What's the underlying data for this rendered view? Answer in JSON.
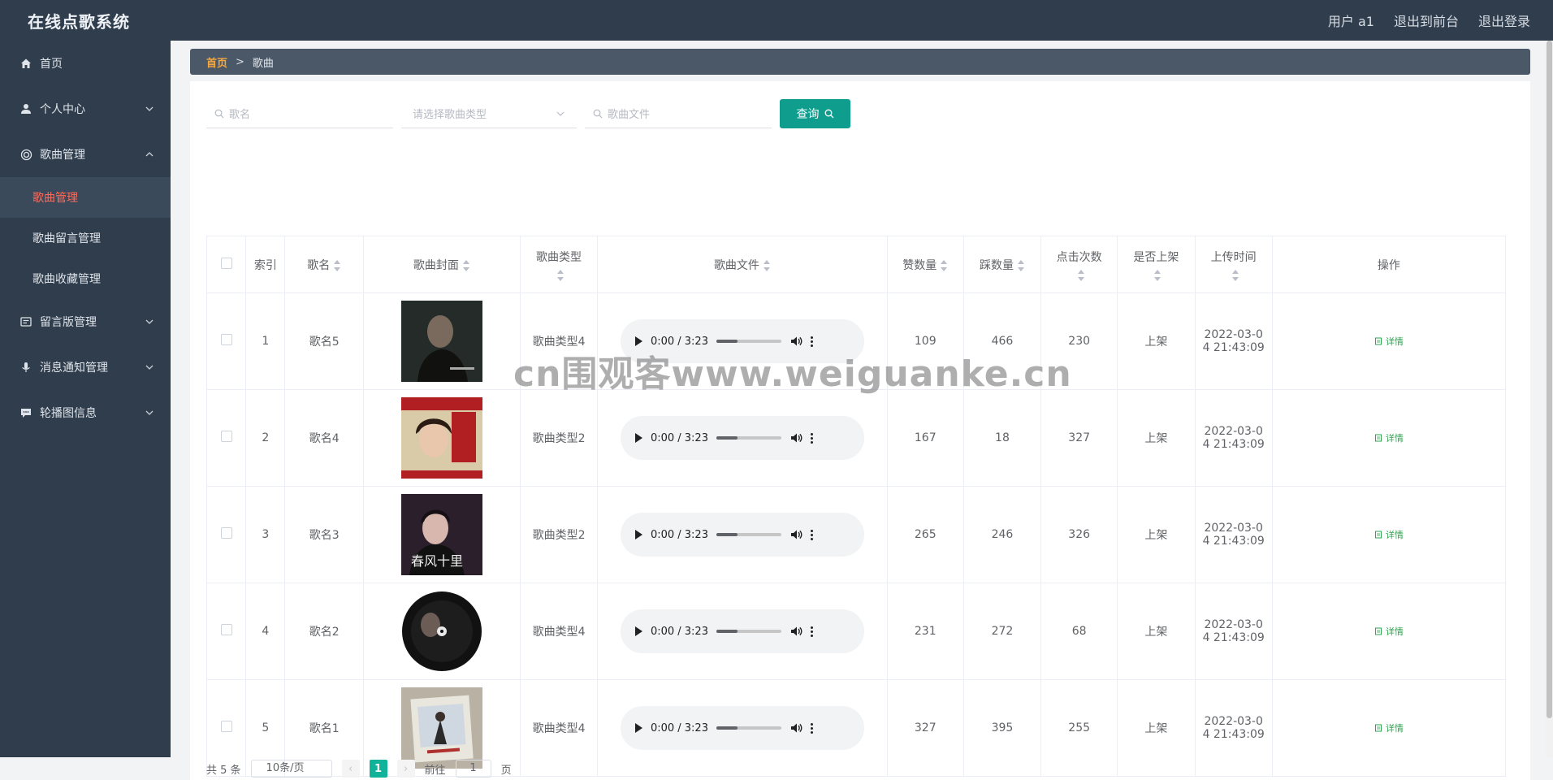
{
  "app": {
    "title": "在线点歌系统"
  },
  "topbar": {
    "user": "用户 a1",
    "to_front": "退出到前台",
    "logout": "退出登录"
  },
  "sidebar": {
    "items": [
      {
        "label": "首页",
        "icon": "home-icon"
      },
      {
        "label": "个人中心",
        "icon": "user-icon"
      },
      {
        "label": "歌曲管理",
        "icon": "music-icon"
      },
      {
        "label": "留言版管理",
        "icon": "message-board-icon"
      },
      {
        "label": "消息通知管理",
        "icon": "microphone-icon"
      },
      {
        "label": "轮播图信息",
        "icon": "chat-icon"
      }
    ],
    "submenu": [
      "歌曲管理",
      "歌曲留言管理",
      "歌曲收藏管理"
    ]
  },
  "breadcrumb": {
    "home": "首页",
    "sep": ">",
    "current": "歌曲"
  },
  "search": {
    "name_placeholder": "歌名",
    "type_placeholder": "请选择歌曲类型",
    "file_placeholder": "歌曲文件",
    "query_label": "查询"
  },
  "table": {
    "headers": [
      "索引",
      "歌名",
      "歌曲封面",
      "歌曲类型",
      "歌曲文件",
      "赞数量",
      "踩数量",
      "点击次数",
      "是否上架",
      "上传时间",
      "操作"
    ],
    "rows": [
      {
        "index": "1",
        "name": "歌名5",
        "type": "歌曲类型4",
        "time_text": "0:00 / 3:23",
        "likes": "109",
        "dislikes": "466",
        "clicks": "230",
        "status": "上架",
        "upload_a": "2022-03-0",
        "upload_b": "4 21:43:09",
        "action": "详情"
      },
      {
        "index": "2",
        "name": "歌名4",
        "type": "歌曲类型2",
        "time_text": "0:00 / 3:23",
        "likes": "167",
        "dislikes": "18",
        "clicks": "327",
        "status": "上架",
        "upload_a": "2022-03-0",
        "upload_b": "4 21:43:09",
        "action": "详情"
      },
      {
        "index": "3",
        "name": "歌名3",
        "type": "歌曲类型2",
        "time_text": "0:00 / 3:23",
        "likes": "265",
        "dislikes": "246",
        "clicks": "326",
        "status": "上架",
        "upload_a": "2022-03-0",
        "upload_b": "4 21:43:09",
        "action": "详情"
      },
      {
        "index": "4",
        "name": "歌名2",
        "type": "歌曲类型4",
        "time_text": "0:00 / 3:23",
        "likes": "231",
        "dislikes": "272",
        "clicks": "68",
        "status": "上架",
        "upload_a": "2022-03-0",
        "upload_b": "4 21:43:09",
        "action": "详情"
      },
      {
        "index": "5",
        "name": "歌名1",
        "type": "歌曲类型4",
        "time_text": "0:00 / 3:23",
        "likes": "327",
        "dislikes": "395",
        "clicks": "255",
        "status": "上架",
        "upload_a": "2022-03-0",
        "upload_b": "4 21:43:09",
        "action": "详情"
      }
    ]
  },
  "pager": {
    "total": "共 5 条",
    "page_size": "10条/页",
    "current": "1",
    "goto": "前往",
    "goto_value": "1",
    "page_unit": "页"
  },
  "watermark": "cn围观客www.weiguanke.cn",
  "colors": {
    "sidebar_bg": "#2f3d4d",
    "accent": "#0f9d8e",
    "active_menu_text": "#ff6b5b"
  }
}
